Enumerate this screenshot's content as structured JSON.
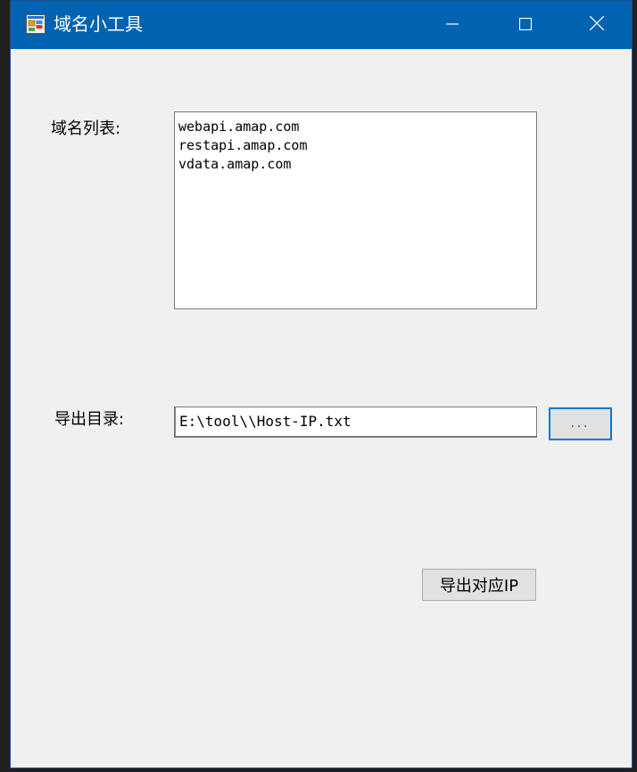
{
  "window": {
    "title": "域名小工具",
    "icons": {
      "app": "app-icon",
      "minimize": "minimize-icon",
      "maximize": "maximize-icon",
      "close": "close-icon"
    }
  },
  "form": {
    "domain_list_label": "域名列表:",
    "domain_list_value": "webapi.amap.com\nrestapi.amap.com\nvdata.amap.com",
    "export_dir_label": "导出目录:",
    "export_dir_value": "E:\\tool\\\\Host-IP.txt",
    "browse_label": "...",
    "export_button_label": "导出对应IP"
  },
  "colors": {
    "titlebar": "#0063b1",
    "window_bg": "#f0f0f0",
    "focus_border": "#0078d7"
  }
}
